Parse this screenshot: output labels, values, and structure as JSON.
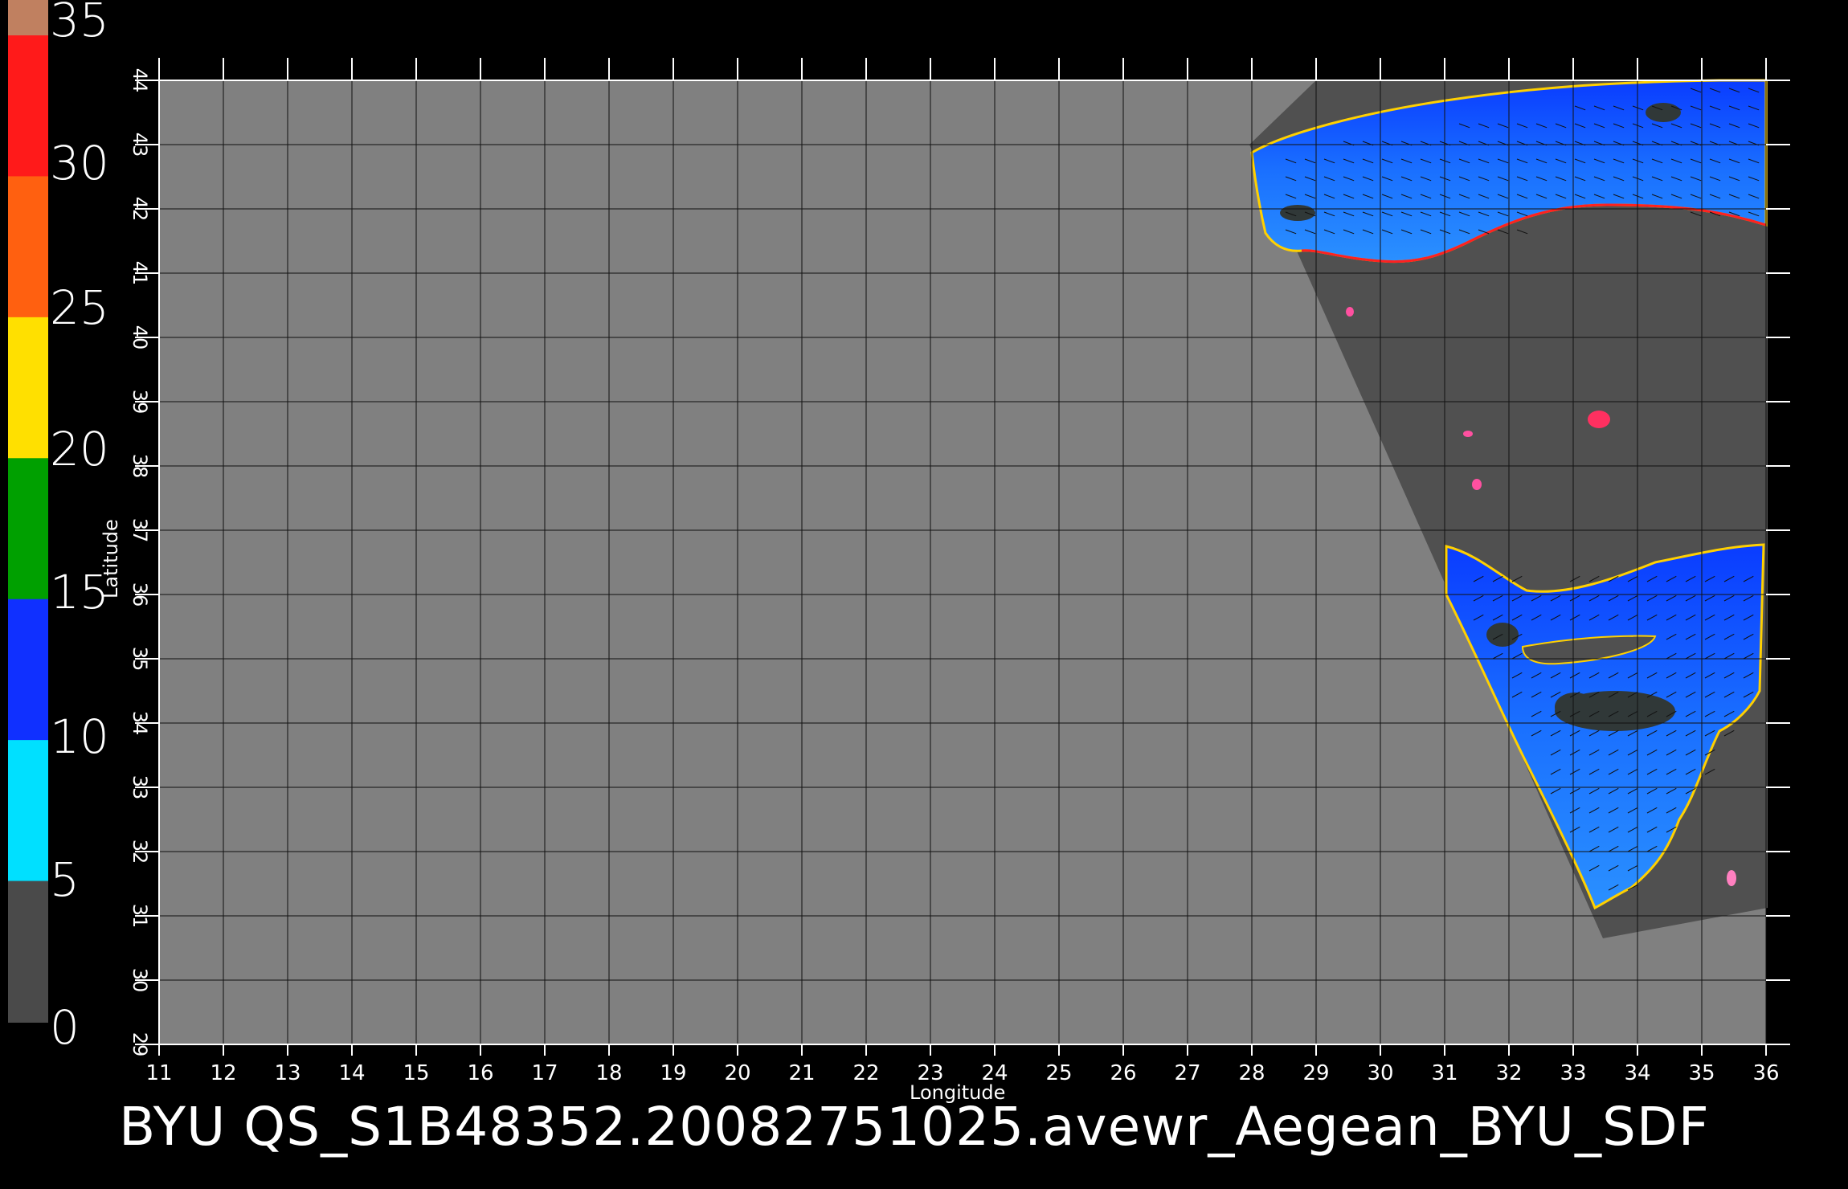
{
  "colorbar": {
    "labels": [
      "35",
      "30",
      "25",
      "20",
      "15",
      "10",
      "5",
      "0"
    ],
    "segments": [
      "#c08060",
      "#ff1a1a",
      "#ff6010",
      "#ffe000",
      "#00a000",
      "#1030ff",
      "#00e0ff",
      "#4a4a4a"
    ]
  },
  "map": {
    "x_ticks": [
      "11",
      "12",
      "13",
      "14",
      "15",
      "16",
      "17",
      "18",
      "19",
      "20",
      "21",
      "22",
      "23",
      "24",
      "25",
      "26",
      "27",
      "28",
      "29",
      "30",
      "31",
      "32",
      "33",
      "34",
      "35",
      "36"
    ],
    "y_ticks": [
      "29",
      "30",
      "31",
      "32",
      "33",
      "34",
      "35",
      "36",
      "37",
      "38",
      "39",
      "40",
      "41",
      "42",
      "43",
      "44"
    ],
    "xlabel": "Longitude",
    "ylabel": "Latitude",
    "background_color": "#808080",
    "swath_color": "#505050",
    "grid_color": "#111111",
    "sea_color": "#1466ff"
  },
  "footer": {
    "title": "BYU  QS_S1B48352.20082751025.avewr_Aegean_BYU_SDF"
  }
}
